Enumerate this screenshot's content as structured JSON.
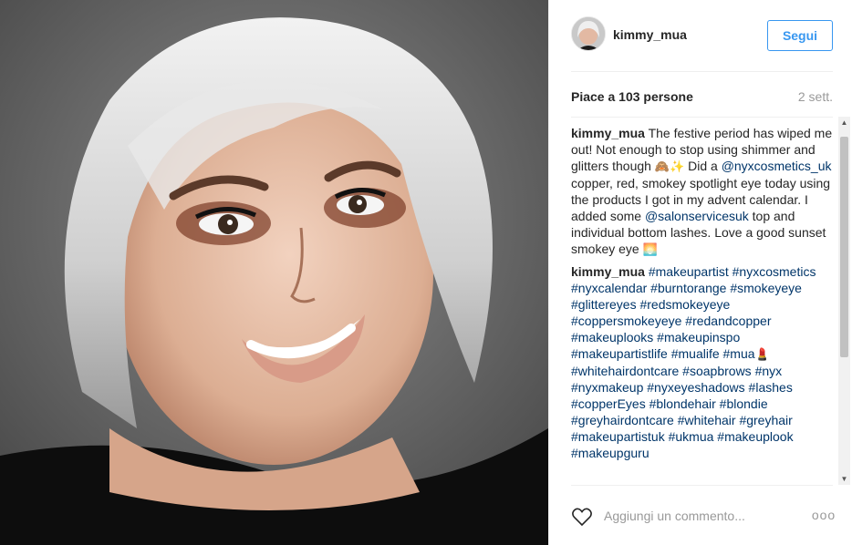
{
  "post": {
    "username": "kimmy_mua",
    "follow_label": "Segui",
    "likes": "Piace a 103 persone",
    "age": "2 sett."
  },
  "caption": {
    "user": "kimmy_mua",
    "text_1": " The festive period has wiped me out! Not enough to stop using shimmer and glitters though ",
    "emoji_1": "🙈✨",
    "text_2": " Did a ",
    "mention_1": "@nyxcosmetics_uk",
    "text_3": " copper, red, smokey spotlight eye today using the products I got in my advent calendar. I added some ",
    "mention_2": "@salonservicesuk",
    "text_4": " top and individual bottom lashes. Love a good sunset smokey eye ",
    "emoji_2": "🌅"
  },
  "hashtag_comment": {
    "user": "kimmy_mua",
    "tags_1": "#makeupartist #nyxcosmetics #nyxcalendar #burntorange #smokeyeye #glittereyes #redsmokeyeye #coppersmokeyeye #redandcopper #makeuplooks #makeupinspo #makeupartistlife #mualife #mua",
    "emoji": "💄",
    "tags_2": " #whitehairdontcare #soapbrows #nyx #nyxmakeup #nyxeyeshadows #lashes #copperEyes #blondehair #blondie #greyhairdontcare #whitehair #greyhair #makeupartistuk #ukmua #makeuplook #makeupguru"
  },
  "footer": {
    "comment_placeholder": "Aggiungi un commento...",
    "more_label": "ooo"
  },
  "colors": {
    "accent": "#3897f0",
    "link": "#003569",
    "muted": "#999999"
  },
  "icons": [
    "heart-icon",
    "more-options-icon",
    "scroll-up-icon",
    "scroll-down-icon"
  ]
}
